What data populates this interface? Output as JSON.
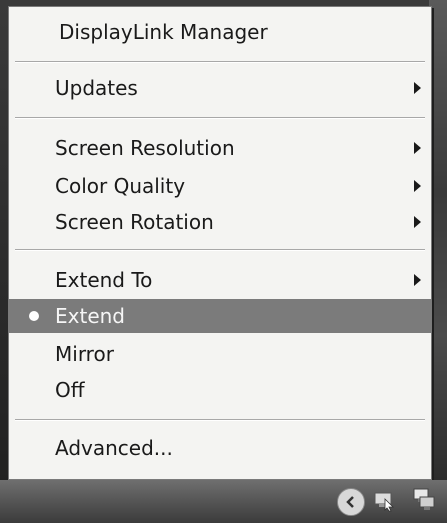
{
  "menu": {
    "title": "DisplayLink Manager",
    "updates": "Updates",
    "screen_resolution": "Screen Resolution",
    "color_quality": "Color Quality",
    "screen_rotation": "Screen Rotation",
    "extend_to": "Extend To",
    "extend": "Extend",
    "mirror": "Mirror",
    "off": "Off",
    "advanced": "Advanced...",
    "selected_item": "Extend"
  },
  "colors": {
    "menu_background": "#f4f4f2",
    "selected_background": "#7b7b7b",
    "selected_text": "#f6f6f6"
  },
  "icons": {
    "tray": [
      "chevron-left-icon",
      "displaylink-tray-icon",
      "network-icon"
    ]
  }
}
